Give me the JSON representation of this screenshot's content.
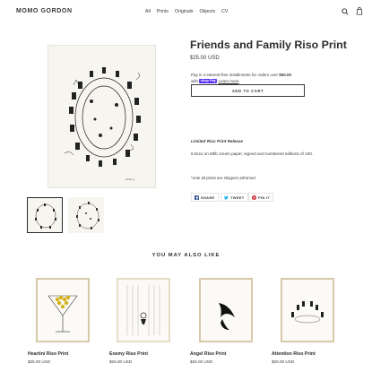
{
  "store": {
    "logo": "MOMO GORDON",
    "nav": [
      "All",
      "Prints",
      "Originals",
      "Objects",
      "CV"
    ]
  },
  "header_icons": [
    "search-icon",
    "cart-icon"
  ],
  "product": {
    "title": "Friends and Family Riso Print",
    "price": "$25.00 USD",
    "installments_prefix": "Pay in 4 interest-free installments for orders over ",
    "installments_amount": "$50.00",
    "installments_with": "with",
    "shop_pay": "shop Pay",
    "learn_more": "Learn more",
    "add_to_cart": "ADD TO CART",
    "desc_title": "Limited Riso Print Release",
    "desc_details": "8.5x11 on 60lb cream paper, signed and numbered editions of 100.",
    "desc_note": "*note all prints are shipped unframed",
    "share": {
      "facebook": "SHARE",
      "twitter": "TWEET",
      "pinterest": "PIN IT"
    }
  },
  "related": {
    "heading": "YOU MAY ALSO LIKE",
    "items": [
      {
        "name": "Heartini Riso Print",
        "price": "$25.00 USD"
      },
      {
        "name": "Enemy Riso Print",
        "price": "$25.00 USD"
      },
      {
        "name": "Angel Riso Print",
        "price": "$25.00 USD"
      },
      {
        "name": "Attention Riso Print",
        "price": "$25.00 USD"
      }
    ]
  },
  "colors": {
    "accent": "#5a31f4",
    "frame": "#d7c9a9",
    "text": "#3a3a3a"
  }
}
